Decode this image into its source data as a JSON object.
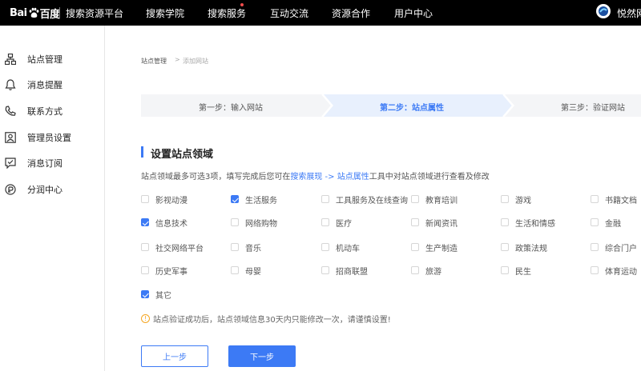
{
  "header": {
    "logo_left": "Bai",
    "logo_right": "百度",
    "platform": "搜索资源平台",
    "nav": [
      "搜索学院",
      "搜索服务",
      "互动交流",
      "资源合作",
      "用户中心"
    ],
    "user": "悦然网"
  },
  "sidebar": {
    "items": [
      {
        "label": "站点管理",
        "icon": "site-icon"
      },
      {
        "label": "消息提醒",
        "icon": "bell-icon"
      },
      {
        "label": "联系方式",
        "icon": "phone-icon"
      },
      {
        "label": "管理员设置",
        "icon": "admin-icon"
      },
      {
        "label": "消息订阅",
        "icon": "subscribe-icon"
      },
      {
        "label": "分润中心",
        "icon": "profit-icon"
      }
    ]
  },
  "breadcrumb": {
    "parent": "站点管理",
    "sep": ">",
    "current": "添加网站"
  },
  "steps": [
    {
      "label": "第一步：输入网站",
      "active": false
    },
    {
      "label": "第二步：站点属性",
      "active": true
    },
    {
      "label": "第三步：验证网站",
      "active": false
    }
  ],
  "section": {
    "title": "设置站点领域",
    "desc_pre": "站点领域最多可选3项，填写完成后您可在",
    "desc_link": "搜索展现 -> 站点属性",
    "desc_post": "工具中对站点领域进行查看及修改"
  },
  "categories": [
    {
      "label": "影视动漫",
      "checked": false
    },
    {
      "label": "生活服务",
      "checked": true
    },
    {
      "label": "工具服务及在线查询",
      "checked": false
    },
    {
      "label": "教育培训",
      "checked": false
    },
    {
      "label": "游戏",
      "checked": false
    },
    {
      "label": "书籍文档",
      "checked": false
    },
    {
      "label": "信息技术",
      "checked": true
    },
    {
      "label": "网络购物",
      "checked": false
    },
    {
      "label": "医疗",
      "checked": false
    },
    {
      "label": "新闻资讯",
      "checked": false
    },
    {
      "label": "生活和情感",
      "checked": false
    },
    {
      "label": "金融",
      "checked": false
    },
    {
      "label": "社交网络平台",
      "checked": false
    },
    {
      "label": "音乐",
      "checked": false
    },
    {
      "label": "机动车",
      "checked": false
    },
    {
      "label": "生产制造",
      "checked": false
    },
    {
      "label": "政策法规",
      "checked": false
    },
    {
      "label": "综合门户",
      "checked": false
    },
    {
      "label": "历史军事",
      "checked": false
    },
    {
      "label": "母婴",
      "checked": false
    },
    {
      "label": "招商联盟",
      "checked": false
    },
    {
      "label": "旅游",
      "checked": false
    },
    {
      "label": "民生",
      "checked": false
    },
    {
      "label": "体育运动",
      "checked": false
    },
    {
      "label": "其它",
      "checked": true
    }
  ],
  "notice": {
    "icon": "!",
    "text": "站点验证成功后，站点领域信息30天内只能修改一次，请谨慎设置!"
  },
  "buttons": {
    "prev": "上一步",
    "next": "下一步"
  },
  "colors": {
    "accent": "#3c7af5",
    "topbar": "#000000",
    "warning": "#f5a623"
  }
}
